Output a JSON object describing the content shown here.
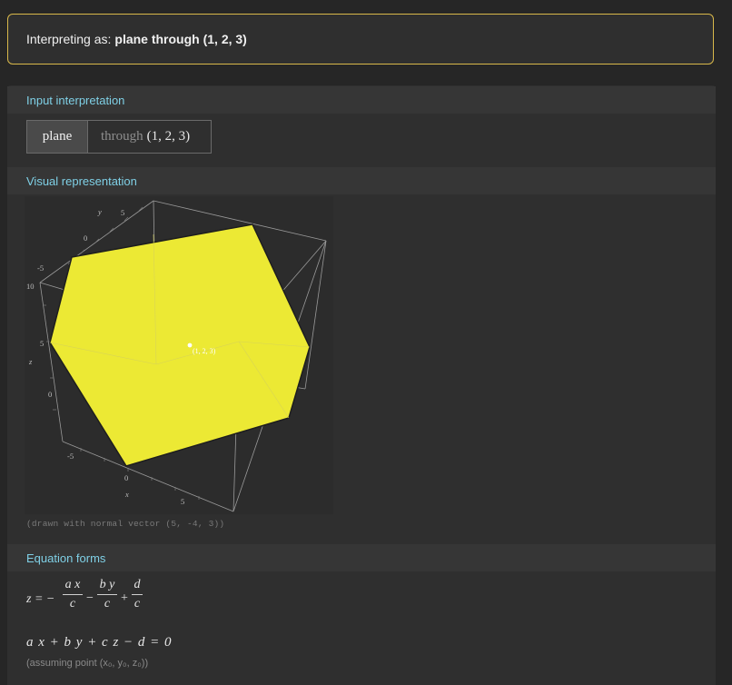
{
  "interpretation": {
    "prefix": "Interpreting as:",
    "value": "plane through (1, 2, 3)"
  },
  "pods": {
    "input_interpretation": {
      "title": "Input interpretation",
      "token1": "plane",
      "token2_word": "through",
      "token2_point": "(1, 2, 3)"
    },
    "visual_representation": {
      "title": "Visual representation",
      "point_label": "(1, 2, 3)",
      "axis_x": "x",
      "axis_y": "y",
      "axis_z": "z",
      "ticks_x": [
        "-5",
        "0",
        "5"
      ],
      "ticks_y": [
        "-5",
        "0",
        "5"
      ],
      "ticks_z": [
        "0",
        "5",
        "10"
      ],
      "caption": "(drawn with normal vector (5, -4, 3))",
      "plane_color": "#ecea36"
    },
    "equation_forms": {
      "title": "Equation forms",
      "eq1": {
        "lhs": "z = −",
        "f1_num": "a x",
        "f1_den": "c",
        "op1": "−",
        "f2_num": "b y",
        "f2_den": "c",
        "op2": "+",
        "f3_num": "d",
        "f3_den": "c"
      },
      "eq2": "a x + b y + c z − d = 0",
      "assumption": "(assuming point (x₀, y₀, z₀))"
    }
  },
  "colors": {
    "accent_header": "#7fd0e6",
    "interp_border": "#d8b84a",
    "background": "#262626"
  }
}
